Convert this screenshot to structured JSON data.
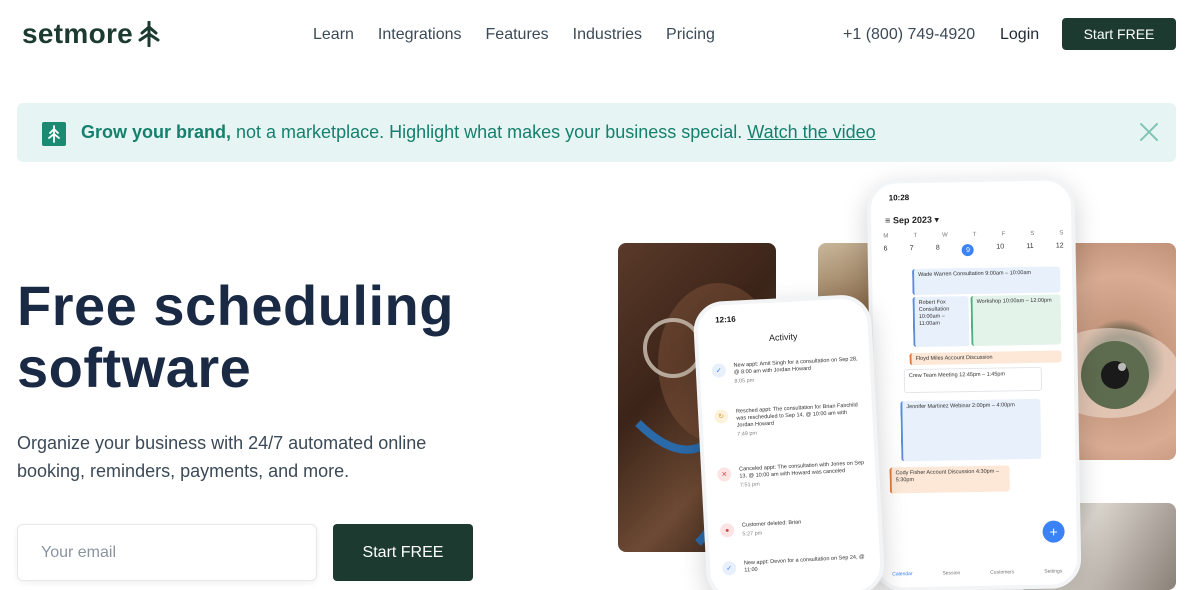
{
  "nav": {
    "logo_text": "setmore",
    "links": [
      "Learn",
      "Integrations",
      "Features",
      "Industries",
      "Pricing"
    ],
    "phone": "+1 (800) 749-4920",
    "login": "Login",
    "cta": "Start FREE"
  },
  "banner": {
    "bold": "Grow your brand,",
    "text": " not a marketplace. Highlight what makes your business special. ",
    "link": "Watch the video",
    "close_icon": "close-icon"
  },
  "hero": {
    "title_line1": "Free scheduling",
    "title_line2": "software",
    "subtitle": "Organize your business with 24/7 automated online booking, reminders, payments, and more.",
    "email_placeholder": "Your email",
    "cta": "Start FREE"
  },
  "phone_calendar": {
    "time": "10:28",
    "month": "Sep 2023",
    "days": [
      "M",
      "T",
      "W",
      "T",
      "F",
      "S",
      "S"
    ],
    "dates": [
      "6",
      "7",
      "8",
      "9",
      "10",
      "11",
      "12"
    ],
    "selected_date": "9",
    "events": [
      "Wade Warren Consultation 9:00am – 10:00am",
      "Robert Fox Consultation 10:00am – 11:00am",
      "Workshop 10:00am – 12:00pm",
      "Floyd Miles Account Discussion",
      "Crew Team Meeting 12:45pm – 1:45pm",
      "Jennifer Martinez Webinar 2:00pm – 4:00pm",
      "Cody Fisher Account Discussion 4:30pm – 5:30pm"
    ],
    "tabs": [
      "Calendar",
      "Session",
      "Customers",
      "Settings"
    ]
  },
  "phone_activity": {
    "time": "12:16",
    "title": "Activity",
    "items": [
      {
        "text": "New appt: Amit Singh for a consultation on Sep 28, @ 8:00 am with Jordan Howard",
        "time": "8:05 pm"
      },
      {
        "text": "Resched appt: The consultation for Brian Fairchild was rescheduled to Sep 14, @ 10:00 am with Jordan Howard",
        "time": "7:49 pm"
      },
      {
        "text": "Canceled appt: The consultation with Jones on Sep 13, @ 10:00 am with Howard was canceled",
        "time": "7:51 pm"
      },
      {
        "text": "Customer deleted: Brian",
        "time": "5:27 pm"
      },
      {
        "text": "New appt: Devon for a consultation on Sep 24, @ 11:00",
        "time": ""
      }
    ]
  }
}
